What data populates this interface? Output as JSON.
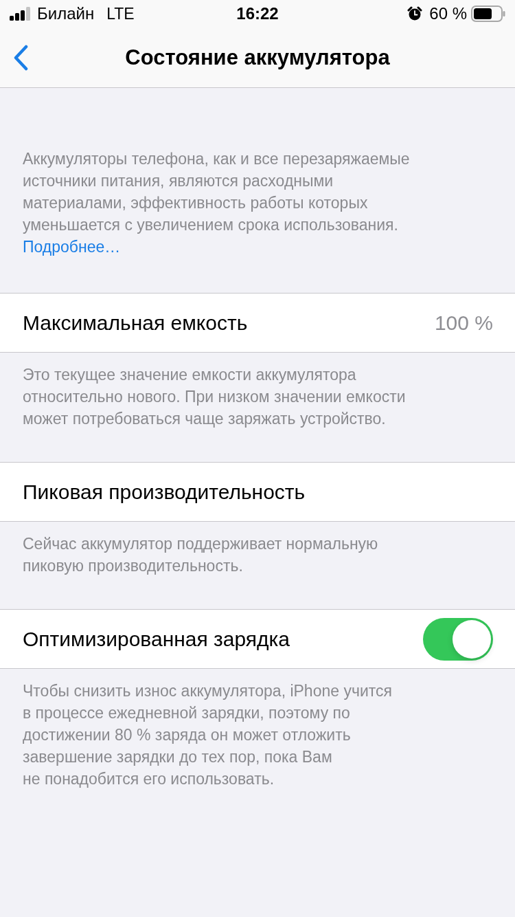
{
  "status_bar": {
    "carrier": "Билайн",
    "network": "LTE",
    "time": "16:22",
    "battery_percent": "60 %"
  },
  "nav_bar": {
    "title": "Состояние аккумулятора"
  },
  "intro": {
    "lines": [
      "Аккумуляторы телефона, как и все перезаряжаемые",
      "источники питания, являются расходными",
      "материалами, эффективность работы которых",
      "уменьшается с увеличением срока использования."
    ],
    "link": "Подробнее…"
  },
  "sections": [
    {
      "kind": "value",
      "label": "Максимальная емкость",
      "value": "100 %",
      "footer": [
        "Это текущее значение емкости аккумулятора",
        "относительно нового. При низком значении емкости",
        "может потребоваться чаще заряжать устройство."
      ]
    },
    {
      "kind": "plain",
      "label": "Пиковая производительность",
      "footer": [
        "Сейчас аккумулятор поддерживает нормальную",
        "пиковую производительность."
      ]
    },
    {
      "kind": "toggle",
      "label": "Оптимизированная зарядка",
      "on": true,
      "footer": [
        "Чтобы снизить износ аккумулятора, iPhone учится",
        "в процессе ежедневной зарядки, поэтому по",
        "достижении 80 % заряда он может отложить",
        "завершение зарядки до тех пор, пока Вам",
        "не понадобится его использовать."
      ]
    }
  ]
}
